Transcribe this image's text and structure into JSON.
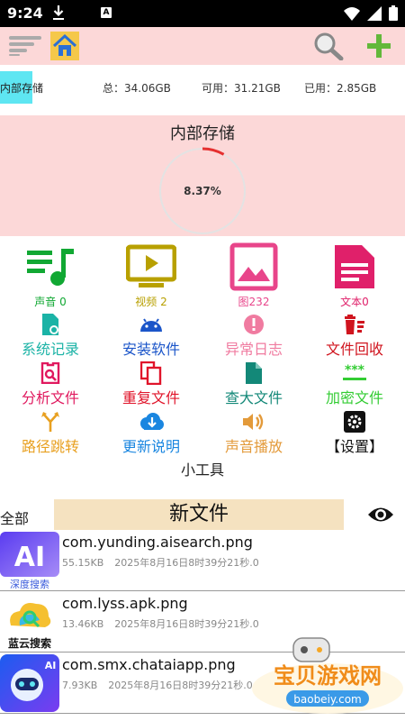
{
  "statusbar": {
    "time": "9:24",
    "a_glyph": "A"
  },
  "toolbar": {
    "menu": "menu-icon",
    "home": "home-icon",
    "search": "search-icon",
    "add": "plus-icon"
  },
  "storage": {
    "tag": "内部存储",
    "total": "总：34.06GB",
    "available": "可用：31.21GB",
    "used": "已用：2.85GB",
    "panel_title": "内部存储",
    "percent_text": "8.37%",
    "percent": 8.37
  },
  "media": [
    {
      "label": "声音 0",
      "color": "#11a833",
      "icon": "music-list-icon"
    },
    {
      "label": "视频 2",
      "color": "#b8a000",
      "icon": "video-screen-icon"
    },
    {
      "label": "图232",
      "color": "#e8458a",
      "icon": "image-icon"
    },
    {
      "label": "文本0",
      "color": "#e0206a",
      "icon": "document-icon"
    }
  ],
  "tools": [
    {
      "label": "系统记录",
      "color": "#1bb3a6",
      "icon": "file-system-icon"
    },
    {
      "label": "安装软件",
      "color": "#1b55c9",
      "icon": "android-icon"
    },
    {
      "label": "异常日志",
      "color": "#f07ba0",
      "icon": "alert-circle-icon"
    },
    {
      "label": "文件回收",
      "color": "#d0141e",
      "icon": "trash-list-icon"
    },
    {
      "label": "分析文件",
      "color": "#e0185e",
      "icon": "file-search-icon"
    },
    {
      "label": "重复文件",
      "color": "#e0142a",
      "icon": "copy-icon"
    },
    {
      "label": "查大文件",
      "color": "#138878",
      "icon": "file-icon"
    },
    {
      "label": "加密文件",
      "color": "#33cc33",
      "icon": "password-icon"
    },
    {
      "label": "路径跳转",
      "color": "#e8a020",
      "icon": "fork-icon"
    },
    {
      "label": "更新说明",
      "color": "#1a86e0",
      "icon": "cloud-download-icon"
    },
    {
      "label": "声音播放",
      "color": "#e39a3a",
      "icon": "volume-icon"
    },
    {
      "label": "【设置】",
      "color": "#111111",
      "icon": "gear-icon"
    }
  ],
  "tools_caption": "小工具",
  "files_bar": {
    "all": "全部",
    "title": "新文件"
  },
  "files": [
    {
      "name": "com.yunding.aisearch.png",
      "size": "55.15KB",
      "date": "2025年8月16日8时39分21秒.0",
      "thumb_text": "AI",
      "thumb_caption": "深度搜索"
    },
    {
      "name": "com.lyss.apk.png",
      "size": "13.46KB",
      "date": "2025年8月16日8时39分21秒.0",
      "thumb_text": "",
      "thumb_caption": "蓝云搜索"
    },
    {
      "name": "com.smx.chataiapp.png",
      "size": "7.93KB",
      "date": "2025年8月16日8时39分21秒.0",
      "thumb_text": "AI",
      "thumb_caption": ""
    }
  ],
  "watermark": {
    "title": "宝贝游戏网",
    "url": "baobeiy.com"
  }
}
